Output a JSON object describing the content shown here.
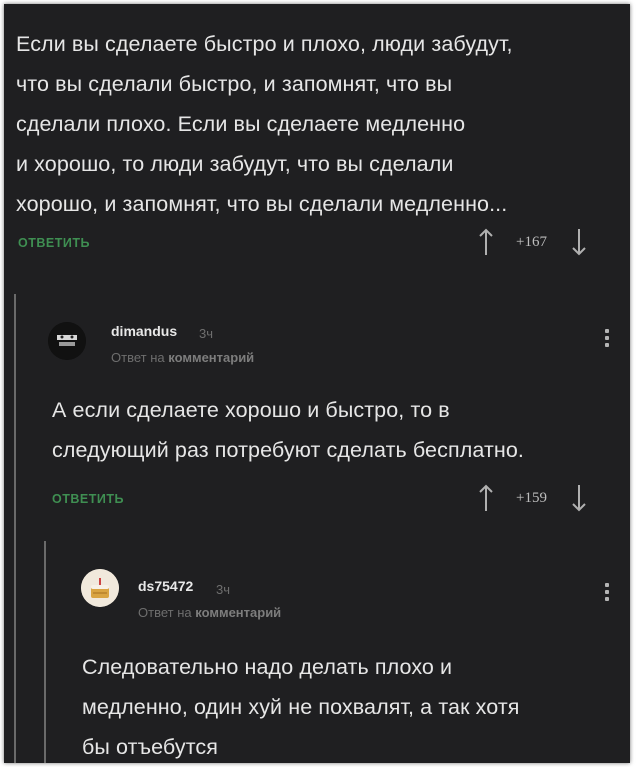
{
  "comments": [
    {
      "text_lines": [
        "Если вы сделаете быстро и плохо, люди забудут,",
        "что вы сделали быстро, и запомнят, что вы",
        "сделали плохо. Если вы сделаете медленно",
        "и хорошо, то люди забудут, что вы сделали",
        "хорошо, и запомнят, что вы сделали медленно..."
      ],
      "reply_label": "ОТВЕТИТЬ",
      "rating": "+167"
    },
    {
      "author": "dimandus",
      "time": "3ч",
      "meta_prefix": "Ответ на",
      "meta_target": "комментарий",
      "avatar_icon": "hamster-avatar-icon",
      "text_lines": [
        "А если сделаете хорошо и быстро, то в",
        "следующий раз потребуют сделать бесплатно."
      ],
      "reply_label": "ОТВЕТИТЬ",
      "rating": "+159"
    },
    {
      "author": "ds75472",
      "time": "3ч",
      "meta_prefix": "Ответ на",
      "meta_target": "комментарий",
      "avatar_icon": "cake-avatar-icon",
      "text_lines": [
        "Следовательно надо делать плохо и",
        "медленно, один хуй не похвалят, а так хотя",
        "бы отъебутся"
      ]
    }
  ],
  "colors": {
    "background": "#1f1f21",
    "text": "#e6e6e6",
    "reply_link": "#3f8f52",
    "muted": "#6e6e6e"
  }
}
